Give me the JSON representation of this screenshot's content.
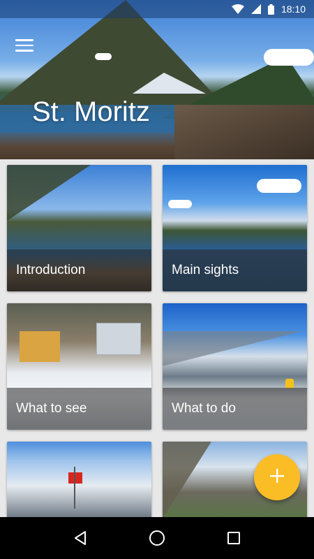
{
  "status_bar": {
    "time": "18:10",
    "icons": [
      "wifi-icon",
      "signal-icon",
      "battery-icon"
    ]
  },
  "header": {
    "title": "St. Moritz",
    "menu_icon": "hamburger-menu-icon"
  },
  "cards": [
    {
      "label": "Introduction"
    },
    {
      "label": "Main sights"
    },
    {
      "label": "What to see"
    },
    {
      "label": "What to do"
    },
    {
      "label": ""
    },
    {
      "label": ""
    }
  ],
  "fab": {
    "icon": "plus-icon",
    "color": "#fbbd26"
  },
  "nav_bar": {
    "icons": [
      "back-icon",
      "home-icon",
      "recents-icon"
    ]
  }
}
